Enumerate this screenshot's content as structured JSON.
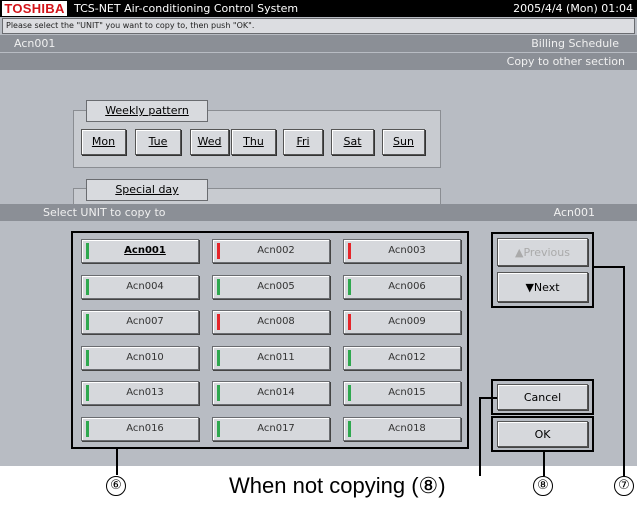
{
  "window": {
    "brand": "TOSHIBA",
    "app_title": "TCS-NET Air-conditioning Control System",
    "datetime": "2005/4/4 (Mon) 01:04"
  },
  "message": "Please select the \"UNIT\" you want to copy to, then push \"OK\".",
  "header": {
    "unit": "Acn001",
    "screen": "Billing Schedule",
    "sub_screen": "Copy to other section"
  },
  "weekly": {
    "title": "Weekly pattern",
    "days": [
      "Mon",
      "Tue",
      "Wed",
      "Thu",
      "Fri",
      "Sat",
      "Sun"
    ]
  },
  "special": {
    "title": "Special day"
  },
  "select_bar": {
    "label": "Select UNIT to copy to",
    "current": "Acn001"
  },
  "indicator_colors": {
    "green": "#2fa84f",
    "red": "#e5252a"
  },
  "units": [
    {
      "label": "Acn001",
      "status": "green",
      "selected": true
    },
    {
      "label": "Acn002",
      "status": "red"
    },
    {
      "label": "Acn003",
      "status": "red"
    },
    {
      "label": "Acn004",
      "status": "green"
    },
    {
      "label": "Acn005",
      "status": "green"
    },
    {
      "label": "Acn006",
      "status": "green"
    },
    {
      "label": "Acn007",
      "status": "green"
    },
    {
      "label": "Acn008",
      "status": "red"
    },
    {
      "label": "Acn009",
      "status": "red"
    },
    {
      "label": "Acn010",
      "status": "green"
    },
    {
      "label": "Acn011",
      "status": "green"
    },
    {
      "label": "Acn012",
      "status": "green"
    },
    {
      "label": "Acn013",
      "status": "green"
    },
    {
      "label": "Acn014",
      "status": "green"
    },
    {
      "label": "Acn015",
      "status": "green"
    },
    {
      "label": "Acn016",
      "status": "green"
    },
    {
      "label": "Acn017",
      "status": "green"
    },
    {
      "label": "Acn018",
      "status": "green"
    }
  ],
  "nav": {
    "previous": "Previous",
    "previous_icon": "▲",
    "next": "Next",
    "next_icon": "▼"
  },
  "actions": {
    "cancel": "Cancel",
    "ok": "OK"
  },
  "callouts": {
    "six": "⑥",
    "seven": "⑦",
    "eight_a": "⑧",
    "eight_b": "⑧",
    "caption": "When not copying (⑧)"
  }
}
